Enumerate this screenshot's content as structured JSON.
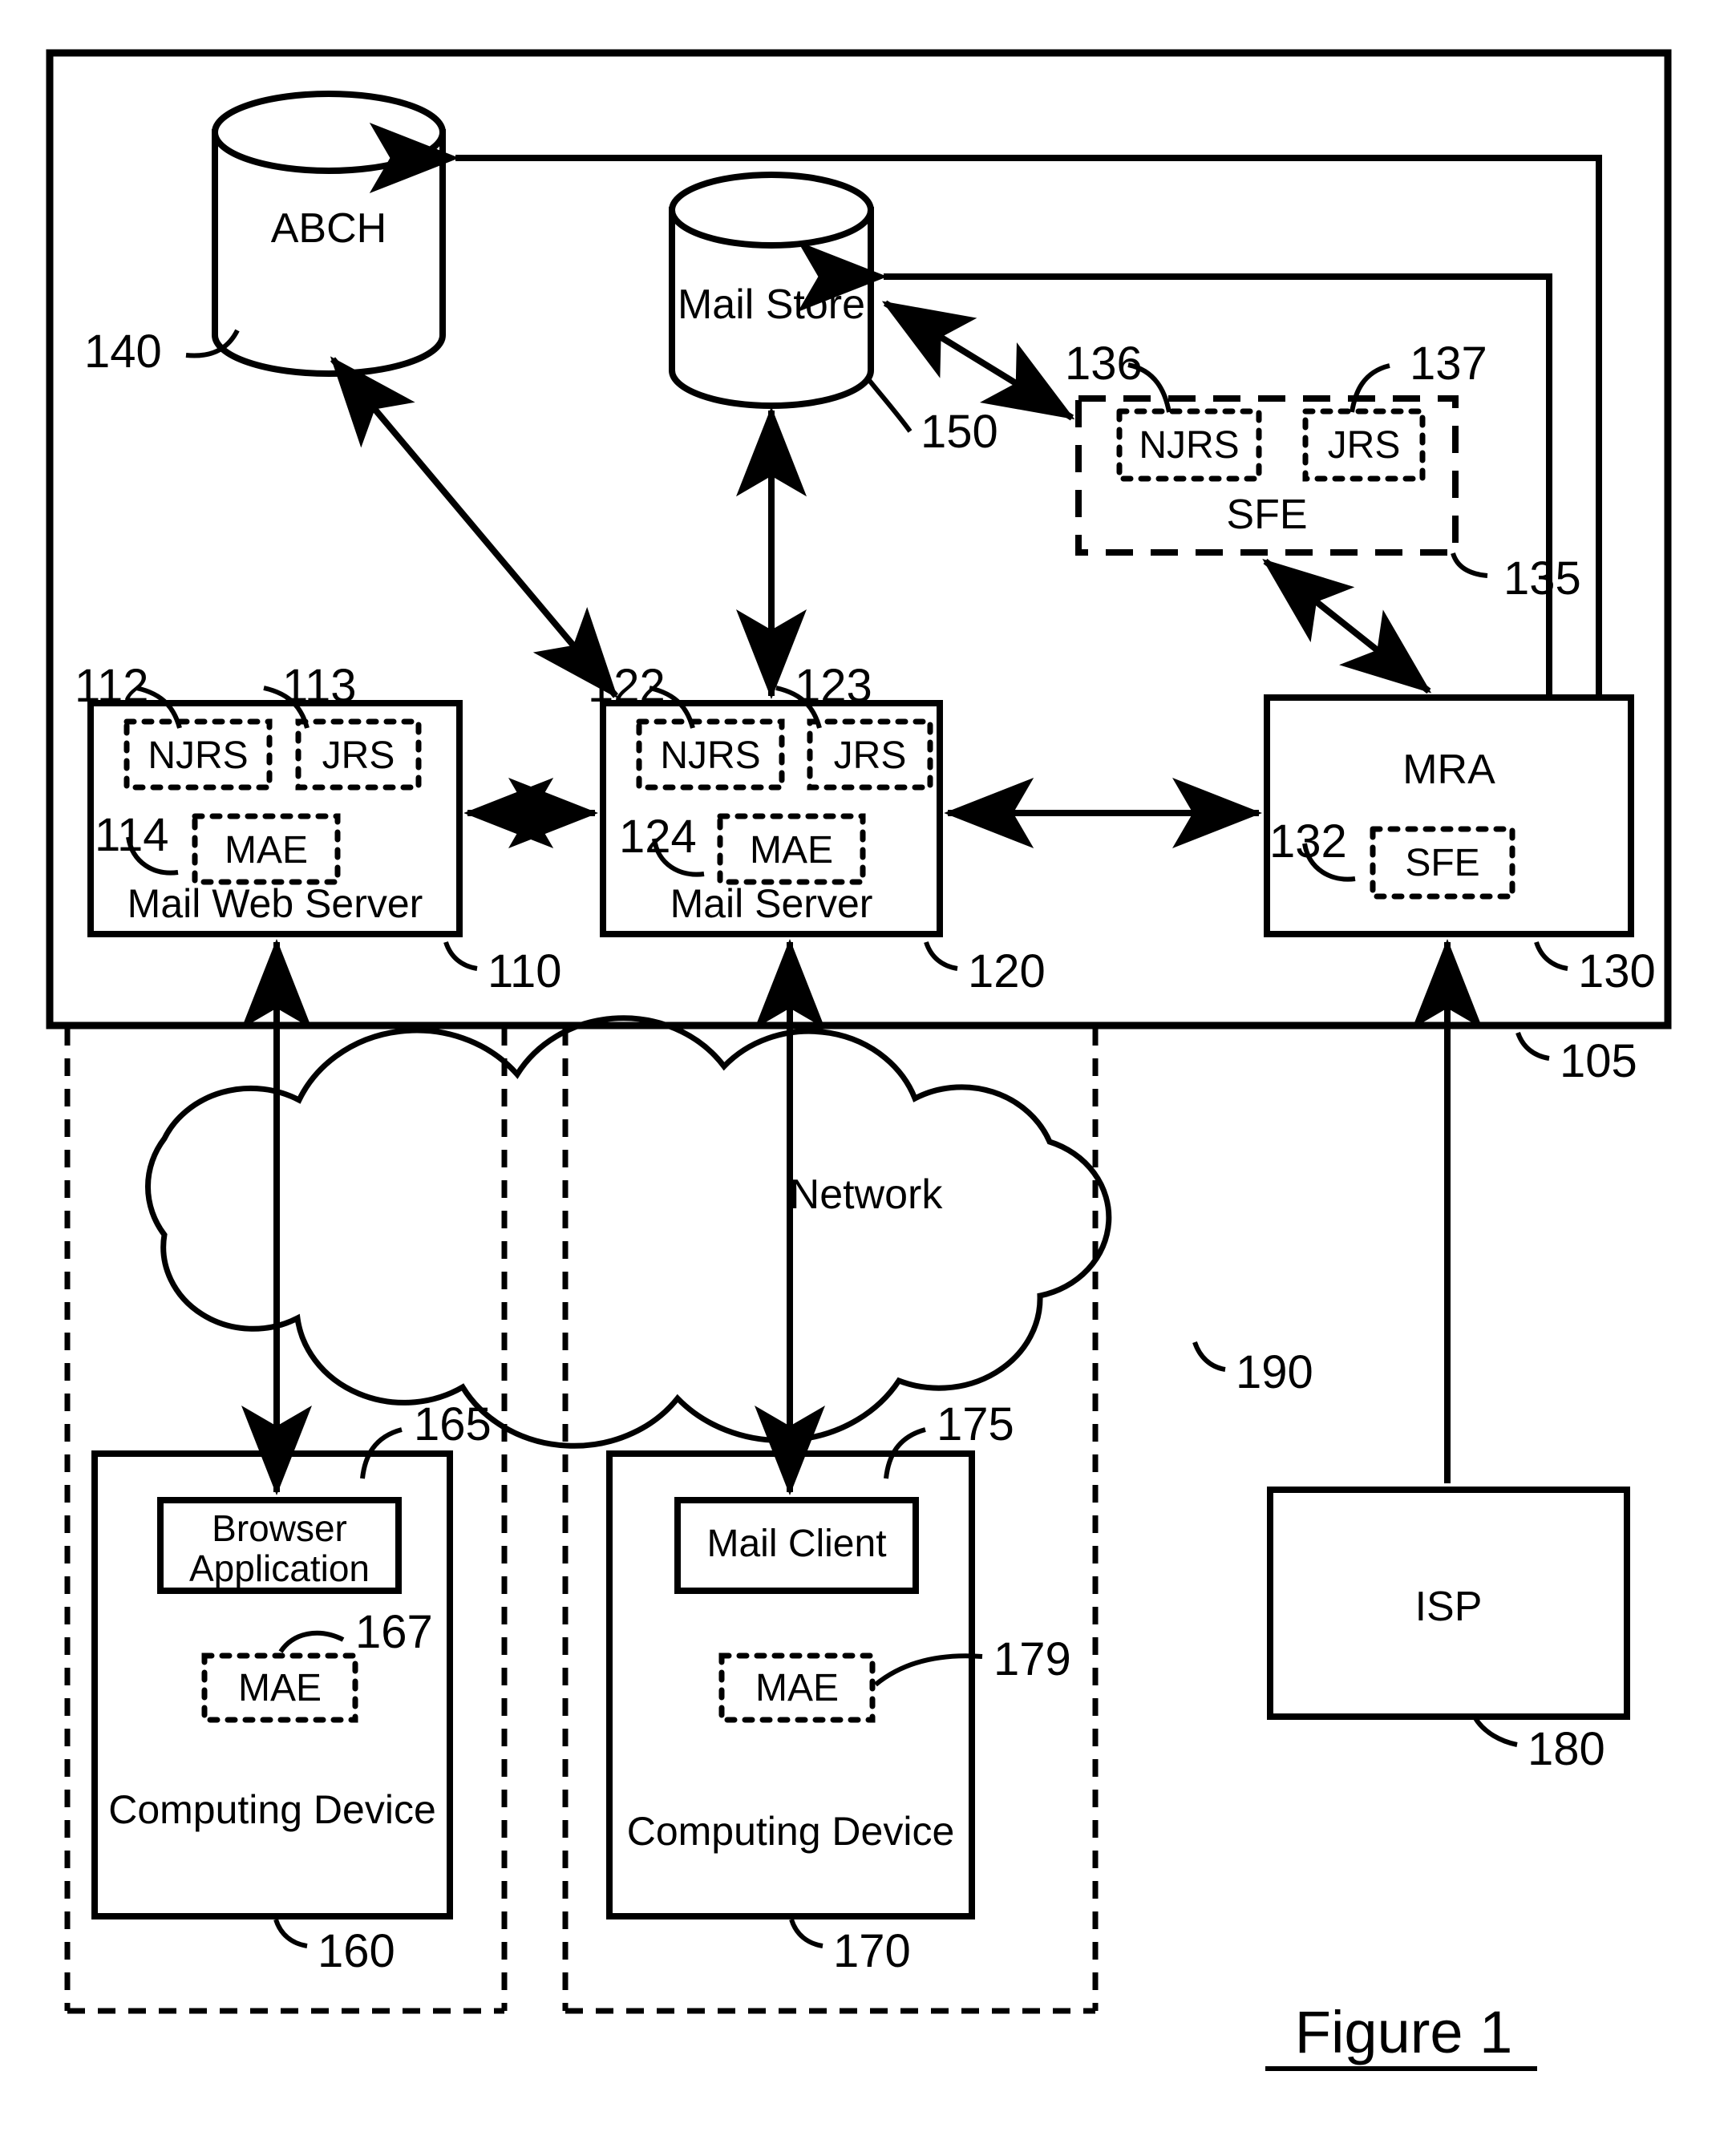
{
  "figure": {
    "caption": "Figure 1"
  },
  "system": {
    "boundary_ref": "105",
    "network": {
      "label": "Network",
      "ref": "190"
    }
  },
  "datastores": [
    {
      "name": "abch",
      "label": "ABCH",
      "ref": "140"
    },
    {
      "name": "mail-store",
      "label": "Mail Store",
      "ref": "150"
    }
  ],
  "sfe_standalone": {
    "label": "SFE",
    "ref": "135",
    "children": [
      {
        "label": "NJRS",
        "ref": "136"
      },
      {
        "label": "JRS",
        "ref": "137"
      }
    ]
  },
  "servers": [
    {
      "name": "mail-web-server",
      "label": "Mail Web Server",
      "ref": "110",
      "children": [
        {
          "label": "NJRS",
          "ref": "112"
        },
        {
          "label": "JRS",
          "ref": "113"
        },
        {
          "label": "MAE",
          "ref": "114"
        }
      ]
    },
    {
      "name": "mail-server",
      "label": "Mail Server",
      "ref": "120",
      "children": [
        {
          "label": "NJRS",
          "ref": "122"
        },
        {
          "label": "JRS",
          "ref": "123"
        },
        {
          "label": "MAE",
          "ref": "124"
        }
      ]
    },
    {
      "name": "mra",
      "label": "MRA",
      "ref": "130",
      "children": [
        {
          "label": "SFE",
          "ref": "132"
        }
      ]
    }
  ],
  "clients": [
    {
      "name": "computing-device-160",
      "label": "Computing Device",
      "ref": "160",
      "app": {
        "label": "Browser Application",
        "line1": "Browser",
        "line2": "Application",
        "ref": "165"
      },
      "module": {
        "label": "MAE",
        "ref": "167"
      }
    },
    {
      "name": "computing-device-170",
      "label": "Computing Device",
      "ref": "170",
      "app": {
        "label": "Mail Client",
        "line1": "Mail Client",
        "line2": "",
        "ref": "175"
      },
      "module": {
        "label": "MAE",
        "ref": "179"
      }
    }
  ],
  "isp": {
    "label": "ISP",
    "ref": "180"
  },
  "colors": {
    "ink": "#000000",
    "paper": "#ffffff"
  }
}
